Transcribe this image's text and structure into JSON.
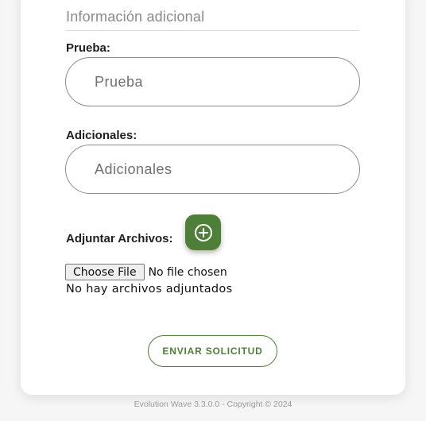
{
  "form": {
    "section_title": "Información adicional",
    "prueba": {
      "label": "Prueba:",
      "placeholder": "Prueba",
      "value": ""
    },
    "adicionales": {
      "label": "Adicionales:",
      "placeholder": "Adicionales",
      "value": ""
    },
    "attachments": {
      "label": "Adjuntar Archivos:",
      "add_icon": "plus-circle-icon",
      "file_button": "Choose File",
      "file_status": "No file chosen",
      "empty_message": "No hay archivos adjuntados"
    },
    "submit_label": "ENVIAR SOLICITUD"
  },
  "footer": {
    "text": "Evolution Wave 3.3.0.0 - Copyright © 2024"
  },
  "colors": {
    "accent": "#4d7f38",
    "background": "#f6f6f6"
  }
}
